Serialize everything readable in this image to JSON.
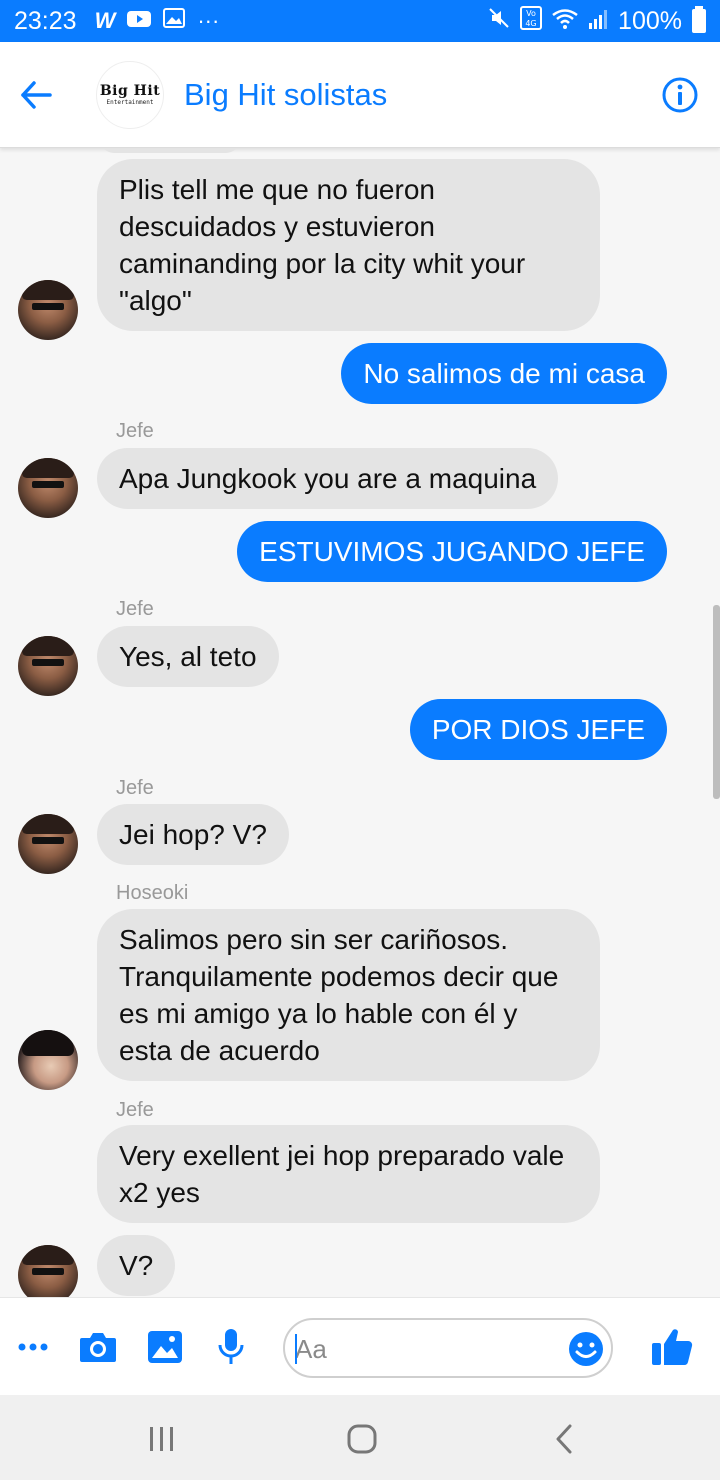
{
  "status_bar": {
    "time": "23:23",
    "battery": "100%",
    "notification_icons": [
      "webtoon-icon",
      "youtube-icon",
      "gallery-icon",
      "more-icon"
    ],
    "system_icons": [
      "mute-icon",
      "volte-4g-icon",
      "wifi-icon",
      "signal-icon",
      "battery-icon"
    ]
  },
  "header": {
    "title": "Big Hit solistas",
    "avatar_logo": "Big Hit",
    "avatar_logo_sub": "Entertainment"
  },
  "messages": [
    {
      "type": "in",
      "text": "Plis tell me que no fueron descuidados y estuvieron caminanding por la city whit your \"algo\""
    },
    {
      "type": "out",
      "text": "No salimos de mi casa"
    },
    {
      "type": "in",
      "sender": "Jefe",
      "text": "Apa Jungkook you are a maquina"
    },
    {
      "type": "out",
      "text": "ESTUVIMOS JUGANDO JEFE"
    },
    {
      "type": "in",
      "sender": "Jefe",
      "text": "Yes, al teto"
    },
    {
      "type": "out",
      "text": "POR DIOS JEFE"
    },
    {
      "type": "in",
      "sender": "Jefe",
      "text": "Jei hop? V?"
    },
    {
      "type": "in",
      "sender": "Hoseoki",
      "text": "Salimos pero sin ser cariñosos. Tranquilamente podemos decir que es mi amigo ya lo hable con él y esta de acuerdo"
    },
    {
      "type": "in",
      "sender": "Jefe",
      "text": "Very exellent jei hop preparado vale x2 yes"
    },
    {
      "type": "in",
      "text": "V?"
    }
  ],
  "composer": {
    "placeholder": "Aa"
  },
  "colors": {
    "accent": "#0a7cff",
    "incoming_bubble": "#e4e4e4",
    "background": "#f6f6f6"
  }
}
